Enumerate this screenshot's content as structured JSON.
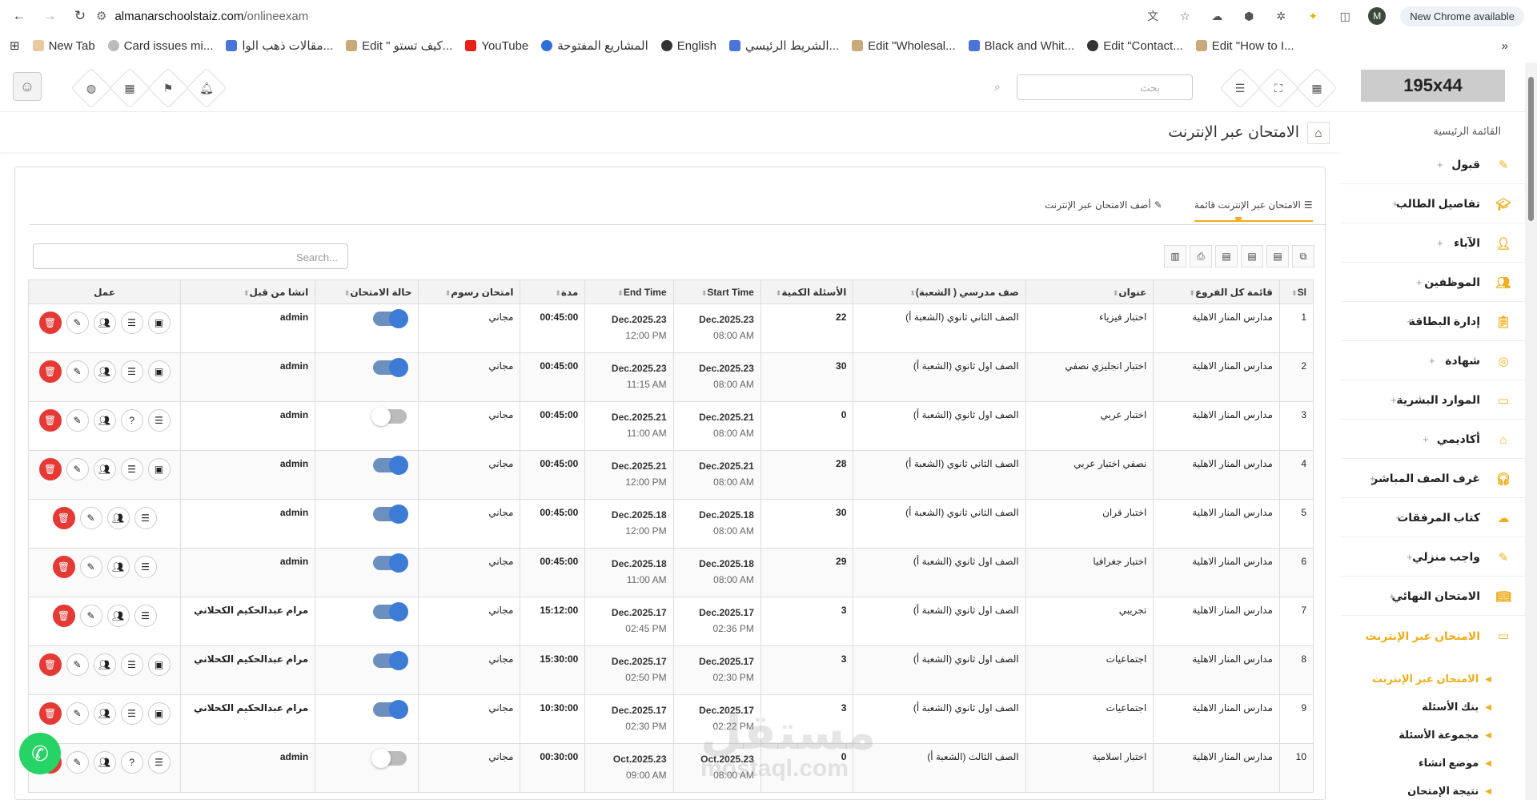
{
  "browser": {
    "url_site": "almanarschoolstaiz.com",
    "url_path": "/onlineexam",
    "profile_initial": "M",
    "new_chrome": "New Chrome available",
    "bookmarks": [
      "New Tab",
      "Card issues mi...",
      "مقالات ذهب الوا...",
      "Edit \" كيف تستو...",
      "YouTube",
      "المشاريع المفتوحة",
      "English",
      "الشريط الرئيسي...",
      "Edit \"Wholesal...",
      "Black and Whit...",
      "Edit \"Contact...",
      "Edit \"How to I..."
    ]
  },
  "header": {
    "search_placeholder": "بحث",
    "logo_text": "195x44"
  },
  "page": {
    "title": "الامتحان عبر الإنترنت"
  },
  "sidebar": {
    "heading": "القائمة الرئيسية",
    "items": [
      "قبول",
      "تفاصيل الطالب",
      "الآباء",
      "الموظفين",
      "إدارة البطاقة",
      "شهادة",
      "الموارد البشرية",
      "أكاديمي",
      "غرف الصف المباشر",
      "كتاب المرفقات",
      "واجب منزلي",
      "الامتحان النهائي",
      "الامتحان عبر الإنترنت"
    ],
    "subitems": [
      "الامتحان عبر الإنترنت",
      "بنك الأسئلة",
      "مجموعة الأسئلة",
      "موضع انشاء",
      "نتيجة الإمتحان"
    ]
  },
  "tabs": {
    "list": "الامتحان عبر الإنترنت قائمة",
    "add": "أضف الامتحان عبر الإنترنت"
  },
  "table": {
    "search_placeholder": "Search...",
    "headers": {
      "sl": "Sl",
      "branch": "قائمة كل الفروع",
      "title": "عنوان",
      "class": "صف مدرسي ( الشعبة)",
      "questions": "الأسئلة الكمية",
      "start": "Start Time",
      "end": "End Time",
      "duration": "مدة",
      "fees": "امتحان رسوم",
      "status": "حالة الامتحان",
      "created": "انشا من قبل",
      "action": "عمل"
    },
    "rows": [
      {
        "sl": "1",
        "branch": "مدارس المنار الاهلية",
        "title": "اختبار فيزياء",
        "class": "الصف الثاني ثانوي (الشعبة أ)",
        "questions": "22",
        "start_date": "Dec.2025.23",
        "start_time": "08:00 AM",
        "end_date": "Dec.2025.23",
        "end_time": "12:00 PM",
        "duration": "00:45:00",
        "fees": "مجاني",
        "status": true,
        "created": "admin"
      },
      {
        "sl": "2",
        "branch": "مدارس المنار الاهلية",
        "title": "اختبار انجليزي نصفي",
        "class": "الصف اول ثانوي (الشعبة أ)",
        "questions": "30",
        "start_date": "Dec.2025.23",
        "start_time": "08:00 AM",
        "end_date": "Dec.2025.23",
        "end_time": "11:15 AM",
        "duration": "00:45:00",
        "fees": "مجاني",
        "status": true,
        "created": "admin"
      },
      {
        "sl": "3",
        "branch": "مدارس المنار الاهلية",
        "title": "اختبار عربي",
        "class": "الصف اول ثانوي (الشعبة أ)",
        "questions": "0",
        "start_date": "Dec.2025.21",
        "start_time": "08:00 AM",
        "end_date": "Dec.2025.21",
        "end_time": "11:00 AM",
        "duration": "00:45:00",
        "fees": "مجاني",
        "status": false,
        "created": "admin"
      },
      {
        "sl": "4",
        "branch": "مدارس المنار الاهلية",
        "title": "نصفي اختبار عربي",
        "class": "الصف الثاني ثانوي (الشعبة أ)",
        "questions": "28",
        "start_date": "Dec.2025.21",
        "start_time": "08:00 AM",
        "end_date": "Dec.2025.21",
        "end_time": "12:00 PM",
        "duration": "00:45:00",
        "fees": "مجاني",
        "status": true,
        "created": "admin"
      },
      {
        "sl": "5",
        "branch": "مدارس المنار الاهلية",
        "title": "اختبار قران",
        "class": "الصف الثاني ثانوي (الشعبة أ)",
        "questions": "30",
        "start_date": "Dec.2025.18",
        "start_time": "08:00 AM",
        "end_date": "Dec.2025.18",
        "end_time": "12:00 PM",
        "duration": "00:45:00",
        "fees": "مجاني",
        "status": true,
        "created": "admin"
      },
      {
        "sl": "6",
        "branch": "مدارس المنار الاهلية",
        "title": "اختبار جغرافيا",
        "class": "الصف اول ثانوي (الشعبة أ)",
        "questions": "29",
        "start_date": "Dec.2025.18",
        "start_time": "08:00 AM",
        "end_date": "Dec.2025.18",
        "end_time": "11:00 AM",
        "duration": "00:45:00",
        "fees": "مجاني",
        "status": true,
        "created": "admin"
      },
      {
        "sl": "7",
        "branch": "مدارس المنار الاهلية",
        "title": "تجريبي",
        "class": "الصف اول ثانوي (الشعبة أ)",
        "questions": "3",
        "start_date": "Dec.2025.17",
        "start_time": "02:36 PM",
        "end_date": "Dec.2025.17",
        "end_time": "02:45 PM",
        "duration": "15:12:00",
        "fees": "مجاني",
        "status": true,
        "created": "مرام عبدالحكيم الكحلاني"
      },
      {
        "sl": "8",
        "branch": "مدارس المنار الاهلية",
        "title": "اجتماعيات",
        "class": "الصف اول ثانوي (الشعبة أ)",
        "questions": "3",
        "start_date": "Dec.2025.17",
        "start_time": "02:30 PM",
        "end_date": "Dec.2025.17",
        "end_time": "02:50 PM",
        "duration": "15:30:00",
        "fees": "مجاني",
        "status": true,
        "created": "مرام عبدالحكيم الكحلاني"
      },
      {
        "sl": "9",
        "branch": "مدارس المنار الاهلية",
        "title": "اجتماعيات",
        "class": "الصف اول ثانوي (الشعبة أ)",
        "questions": "3",
        "start_date": "Dec.2025.17",
        "start_time": "02:22 PM",
        "end_date": "Dec.2025.17",
        "end_time": "02:30 PM",
        "duration": "10:30:00",
        "fees": "مجاني",
        "status": true,
        "created": "مرام عبدالحكيم الكحلاني"
      },
      {
        "sl": "10",
        "branch": "مدارس المنار الاهلية",
        "title": "اختبار اسلامية",
        "class": "الصف الثالث (الشعبة أ)",
        "questions": "0",
        "start_date": "Oct.2025.23",
        "start_time": "08:00 AM",
        "end_date": "Oct.2025.23",
        "end_time": "09:00 AM",
        "duration": "00:30:00",
        "fees": "مجاني",
        "status": false,
        "created": "admin"
      }
    ]
  },
  "watermark": {
    "main": "مستقل",
    "sub": "mostaql.com"
  },
  "colors": {
    "accent": "#f0ad1c",
    "toggle_on": "#3c7bd6",
    "delete": "#e53935",
    "whatsapp": "#25d366"
  }
}
